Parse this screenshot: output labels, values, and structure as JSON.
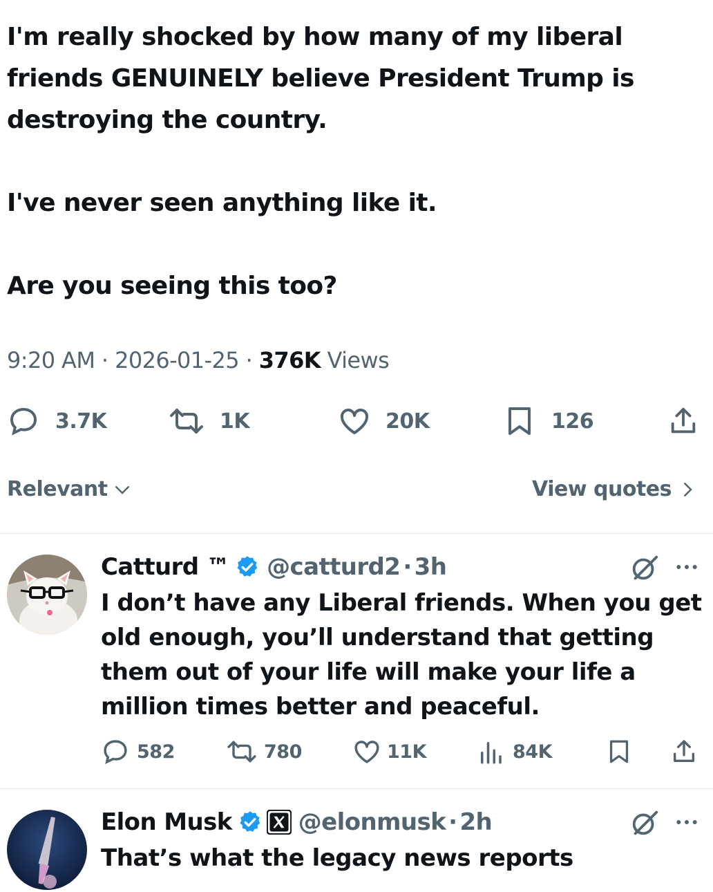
{
  "tweet": {
    "text": "I'm really shocked by how many of my liberal\nfriends GENUINELY believe President Trump is\ndestroying the country.\n\nI've never seen anything like it.\n\nAre you seeing this too?",
    "time": "9:20 AM",
    "date": "2026-01-25",
    "views_count": "376K",
    "views_label": "Views",
    "separator": " · ",
    "stats": {
      "replies": "3.7K",
      "reposts": "1K",
      "likes": "20K",
      "bookmarks": "126"
    }
  },
  "sort": {
    "relevant_label": "Relevant",
    "view_quotes_label": "View quotes"
  },
  "replies": [
    {
      "name": "Catturd ™",
      "handle": "@catturd2",
      "time": "3h",
      "text": "I don’t have any Liberal friends. When you get old enough, you’ll understand that getting them out of your life will make your life a million times better and peaceful.",
      "stats": {
        "replies": "582",
        "reposts": "780",
        "likes": "11K",
        "views": "84K"
      }
    },
    {
      "name": "Elon Musk",
      "handle": "@elonmusk",
      "time": "2h",
      "text": "That’s what the legacy news reports"
    }
  ],
  "colors": {
    "text": "#0f1419",
    "secondary": "#536471",
    "verified": "#1d9bf0",
    "divider": "#e1e6ea"
  },
  "icons": [
    "reply-icon",
    "repost-icon",
    "like-icon",
    "bookmark-icon",
    "share-icon",
    "views-icon",
    "grok-icon",
    "more-icon",
    "verified-badge-icon",
    "x-logo-icon",
    "chevron-down-icon",
    "chevron-right-icon"
  ]
}
